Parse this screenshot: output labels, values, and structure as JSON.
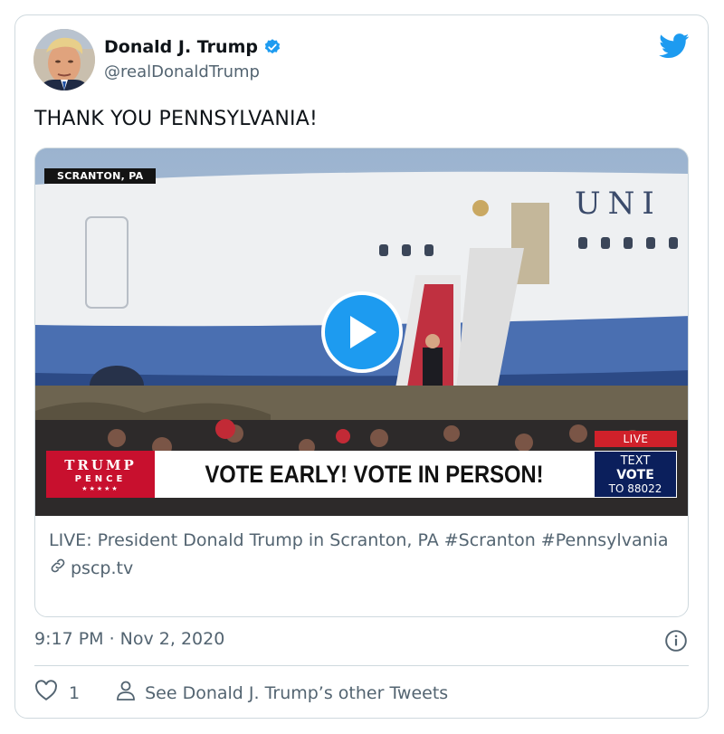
{
  "author": {
    "display_name": "Donald J. Trump",
    "handle": "@realDonaldTrump",
    "verified": true
  },
  "tweet": {
    "text": "THANK YOU PENNSYLVANIA!",
    "timestamp": "9:17 PM · Nov 2, 2020"
  },
  "media": {
    "location_tag": "SCRANTON, PA",
    "live_badge": "LIVE",
    "logo_line1": "TRUMP",
    "logo_line2": "PENCE",
    "logo_stars": "★★★★★",
    "headline": "VOTE EARLY! VOTE IN PERSON!",
    "text_line1": "TEXT",
    "text_line2": "VOTE",
    "text_line3": "TO 88022",
    "plane_text": "UNI"
  },
  "link_card": {
    "title": "LIVE: President Donald Trump in Scranton, PA #Scranton #Pennsylvania",
    "domain": "pscp.tv"
  },
  "actions": {
    "like_count": "1",
    "other_tweets_label": "See Donald J. Trump’s other Tweets"
  },
  "colors": {
    "twitter_blue": "#1d9bf0",
    "secondary_text": "#536471",
    "border": "#cfd9de",
    "live_red": "#d0212a",
    "banner_navy": "#0b1f5c"
  }
}
